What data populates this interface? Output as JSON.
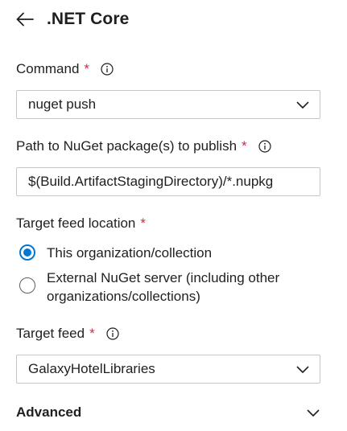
{
  "header": {
    "title": ".NET Core"
  },
  "command": {
    "label": "Command",
    "required": "*",
    "value": "nuget push"
  },
  "path": {
    "label": "Path to NuGet package(s) to publish",
    "required": "*",
    "value": "$(Build.ArtifactStagingDirectory)/*.nupkg"
  },
  "target_location": {
    "label": "Target feed location",
    "required": "*",
    "options": [
      {
        "label": "This organization/collection",
        "selected": true
      },
      {
        "label": "External NuGet server (including other organizations/collections)",
        "selected": false
      }
    ]
  },
  "target_feed": {
    "label": "Target feed",
    "required": "*",
    "value": "GalaxyHotelLibraries"
  },
  "advanced": {
    "label": "Advanced"
  },
  "colors": {
    "accent": "#0078d4",
    "required": "#c4314b",
    "border": "#c8c6c4"
  },
  "icons": [
    "back-arrow-icon",
    "info-icon",
    "chevron-down-icon"
  ]
}
